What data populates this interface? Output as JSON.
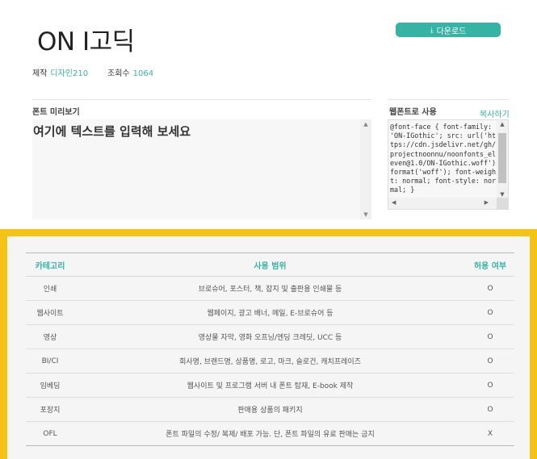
{
  "header": {
    "title": "ON I고딕",
    "download_label": "다운로드",
    "download_icon": "download-icon"
  },
  "meta": {
    "designer_label": "제작",
    "designer_value": "디자인210",
    "views_label": "조회수",
    "views_value": "1064"
  },
  "preview": {
    "label": "폰트 미리보기",
    "text": "여기에 텍스트를 입력해 보세요"
  },
  "embed": {
    "label": "웹폰트로 사용",
    "copy_label": "복사하기",
    "code": "@font-face { font-family: 'ON-IGothic'; src: url('https://cdn.jsdelivr.net/gh/projectnoonnu/noonfonts_eleven@1.0/ON-IGothic.woff') format('woff'); font-weight: normal; font-style: normal; }"
  },
  "license": {
    "headers": [
      "카테고리",
      "사용 범위",
      "허용 여부"
    ],
    "rows": [
      {
        "category": "인쇄",
        "scope": "브로슈어, 포스터, 책, 잡지 및 출판용 인쇄물 등",
        "allowed": "O"
      },
      {
        "category": "웹사이트",
        "scope": "웹페이지, 광고 배너, 메일, E-브로슈어 등",
        "allowed": "O"
      },
      {
        "category": "영상",
        "scope": "영상물 자막, 영화 오프닝/엔딩 크레딧, UCC 등",
        "allowed": "O"
      },
      {
        "category": "BI/CI",
        "scope": "회사명, 브랜드명, 상품명, 로고, 마크, 슬로건, 캐치프레이즈",
        "allowed": "O"
      },
      {
        "category": "임베딩",
        "scope": "웹사이트 및 프로그램 서버 내 폰트 탑재, E-book 제작",
        "allowed": "O"
      },
      {
        "category": "포장지",
        "scope": "판매용 상품의 패키지",
        "allowed": "O"
      },
      {
        "category": "OFL",
        "scope": "폰트 파일의 수정/ 복제/ 배포 가능. 단, 폰트 파일의 유료 판매는 금지",
        "allowed": "X"
      }
    ]
  },
  "colors": {
    "accent": "#36b3a3",
    "highlight": "#f3c316",
    "deny": "#e04848"
  }
}
